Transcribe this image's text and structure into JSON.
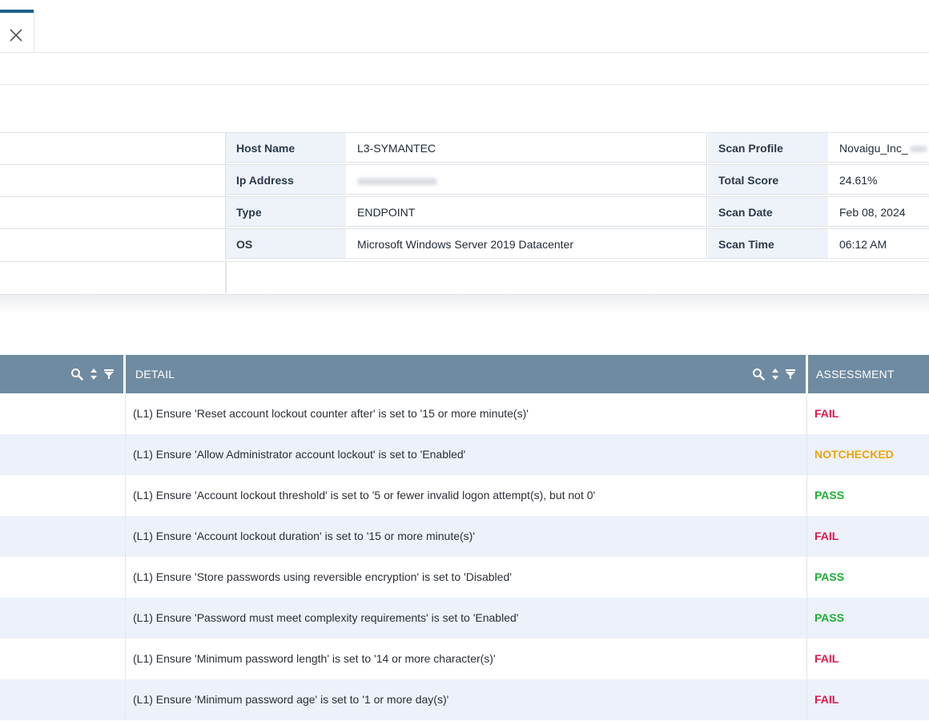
{
  "tabs": {
    "close_icon": "close-icon"
  },
  "host_info": {
    "rows": [
      {
        "label1": "Host Name",
        "value1": "L3-SYMANTEC",
        "label2": "Scan Profile",
        "value2": "Novaigu_Inc_"
      },
      {
        "label1": "Ip Address",
        "value1": "",
        "label2": "Total Score",
        "value2": "24.61%"
      },
      {
        "label1": "Type",
        "value1": "ENDPOINT",
        "label2": "Scan Date",
        "value2": "Feb 08, 2024"
      },
      {
        "label1": "OS",
        "value1": "Microsoft Windows Server 2019 Datacenter",
        "label2": "Scan Time",
        "value2": "06:12 AM"
      }
    ]
  },
  "table": {
    "headers": {
      "col0": "",
      "detail": "DETAIL",
      "assessment": "ASSESSMENT"
    },
    "header_icons": [
      "search-icon",
      "sort-icon",
      "filter-icon"
    ],
    "rows": [
      {
        "detail": "(L1) Ensure 'Reset account lockout counter after' is set to '15 or more minute(s)'",
        "assessment": "FAIL"
      },
      {
        "detail": "(L1) Ensure 'Allow Administrator account lockout' is set to 'Enabled'",
        "assessment": "NOTCHECKED"
      },
      {
        "detail": "(L1) Ensure 'Account lockout threshold' is set to '5 or fewer invalid logon attempt(s), but not 0'",
        "assessment": "PASS"
      },
      {
        "detail": "(L1) Ensure 'Account lockout duration' is set to '15 or more minute(s)'",
        "assessment": "FAIL"
      },
      {
        "detail": "(L1) Ensure 'Store passwords using reversible encryption' is set to 'Disabled'",
        "assessment": "PASS"
      },
      {
        "detail": "(L1) Ensure 'Password must meet complexity requirements' is set to 'Enabled'",
        "assessment": "PASS"
      },
      {
        "detail": "(L1) Ensure 'Minimum password length' is set to '14 or more character(s)'",
        "assessment": "FAIL"
      },
      {
        "detail": "(L1) Ensure 'Minimum password age' is set to '1 or more day(s)'",
        "assessment": "FAIL"
      }
    ]
  },
  "colors": {
    "header_bg": "#6f8ba1",
    "fail": "#e0194d",
    "pass": "#1fae36",
    "notchecked": "#e8a60e",
    "tab_accent": "#1f5f8b"
  }
}
